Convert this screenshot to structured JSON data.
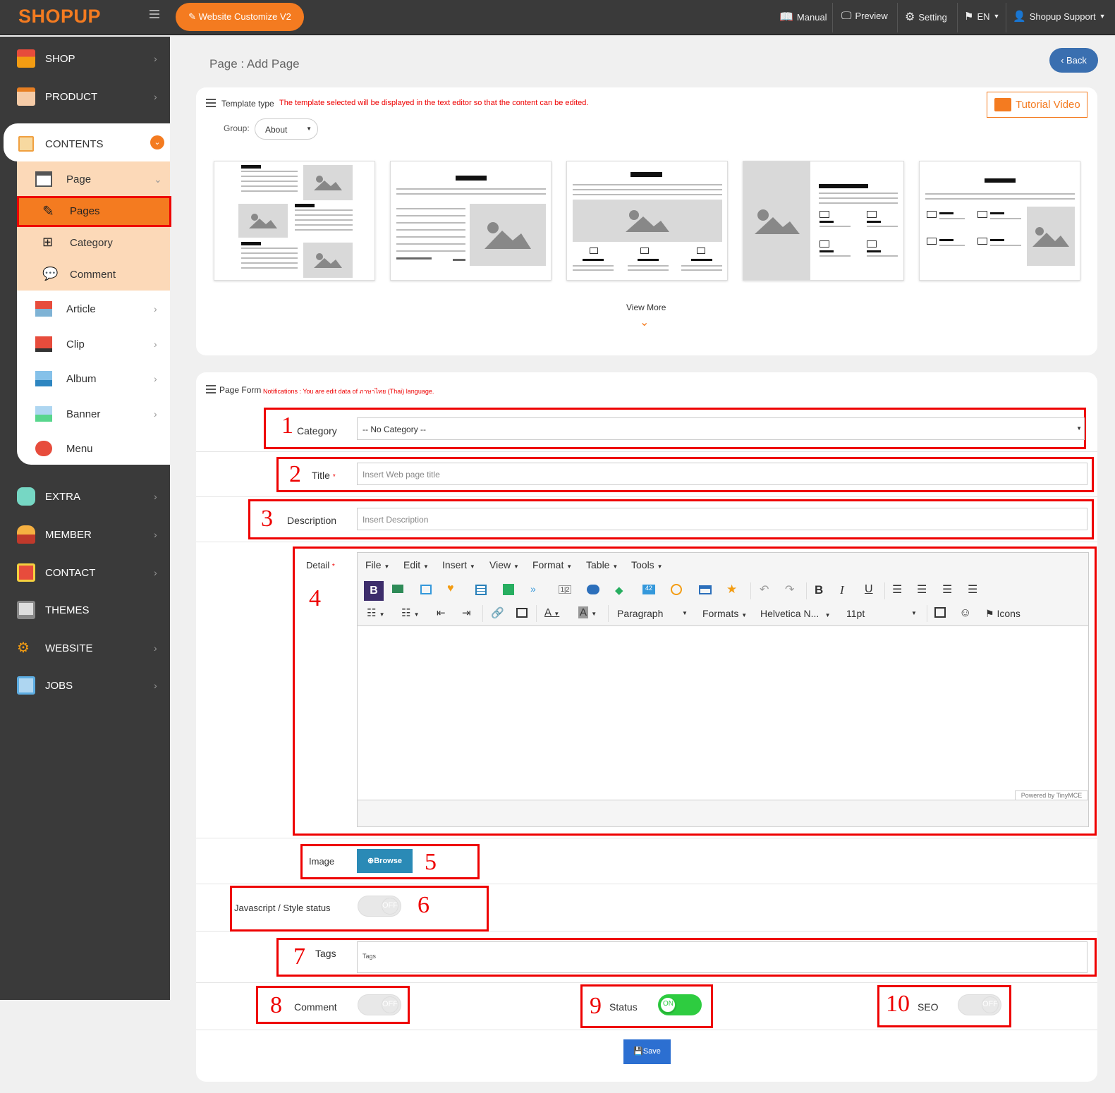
{
  "brand": {
    "logo": "SHOPUP",
    "accent": "#f47b20"
  },
  "topbar": {
    "customize_label": "Website Customize V2",
    "manual": "Manual",
    "preview": "Preview",
    "setting": "Setting",
    "lang": "EN",
    "support": "Shopup Support"
  },
  "sidebar": {
    "shop": "SHOP",
    "product": "PRODUCT",
    "contents": "CONTENTS",
    "page": "Page",
    "pages": "Pages",
    "category": "Category",
    "comment": "Comment",
    "article": "Article",
    "clip": "Clip",
    "album": "Album",
    "banner": "Banner",
    "menu": "Menu",
    "extra": "EXTRA",
    "member": "MEMBER",
    "contact": "CONTACT",
    "themes": "THEMES",
    "website": "WEBSITE",
    "jobs": "JOBS"
  },
  "page": {
    "title": "Page : Add Page",
    "back": "Back"
  },
  "template": {
    "label": "Template type",
    "note": "The template selected will be displayed in the text editor so that the content can be edited.",
    "group_label": "Group:",
    "group_value": "About",
    "tutorial": "Tutorial Video",
    "view_more": "View More"
  },
  "form": {
    "title": "Page Form",
    "notice": "Notifications : You are edit data of ภาษาไทย (Thai) language.",
    "category_label": "Category",
    "category_value": "-- No Category --",
    "title_label": "Title",
    "title_placeholder": "Insert Web page title",
    "desc_label": "Description",
    "desc_placeholder": "Insert Description",
    "detail_label": "Detail",
    "image_label": "Image",
    "browse": "Browse",
    "js_label": "Javascript / Style status",
    "tags_label": "Tags",
    "tags_placeholder": "Tags",
    "comment_label": "Comment",
    "status_label": "Status",
    "seo_label": "SEO",
    "off": "OFF",
    "on": "ON",
    "save": "Save",
    "required": "*"
  },
  "annotations": [
    "1",
    "2",
    "3",
    "4",
    "5",
    "6",
    "7",
    "8",
    "9",
    "10"
  ],
  "editor": {
    "menu": [
      "File",
      "Edit",
      "Insert",
      "View",
      "Format",
      "Table",
      "Tools"
    ],
    "paragraph": "Paragraph",
    "formats": "Formats",
    "font": "Helvetica N...",
    "size": "11pt",
    "icons": "Icons",
    "powered": "Powered by TinyMCE"
  }
}
